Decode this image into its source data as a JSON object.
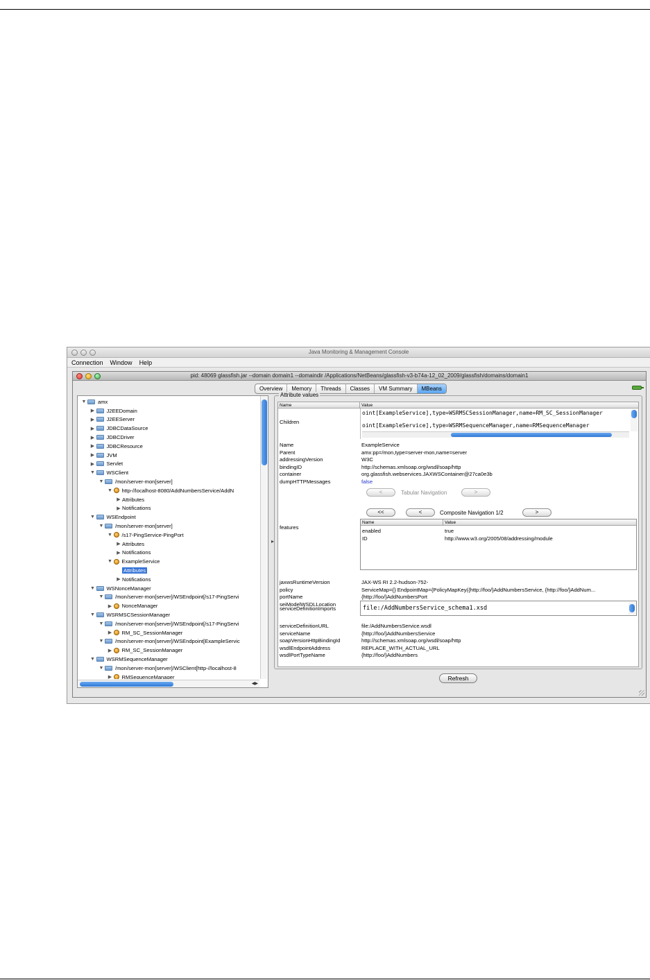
{
  "outer_window": {
    "title": "Java Monitoring & Management Console",
    "menu": [
      "Connection",
      "Window",
      "Help"
    ]
  },
  "inner_window": {
    "title": "pid: 48069 glassfish.jar --domain domain1 --domaindir /Applications/NetBeans/glassfish-v3-b74a-12_02_2009/glassfish/domains/domain1"
  },
  "tabs": [
    {
      "label": "Overview",
      "active": false
    },
    {
      "label": "Memory",
      "active": false
    },
    {
      "label": "Threads",
      "active": false
    },
    {
      "label": "Classes",
      "active": false
    },
    {
      "label": "VM Summary",
      "active": false
    },
    {
      "label": "MBeans",
      "active": true
    }
  ],
  "tree": [
    {
      "label": "amx",
      "depth": 0,
      "state": "expanded",
      "icon": "folder"
    },
    {
      "label": "J2EEDomain",
      "depth": 1,
      "state": "collapsed",
      "icon": "folder"
    },
    {
      "label": "J2EEServer",
      "depth": 1,
      "state": "collapsed",
      "icon": "folder"
    },
    {
      "label": "JDBCDataSource",
      "depth": 1,
      "state": "collapsed",
      "icon": "folder"
    },
    {
      "label": "JDBCDriver",
      "depth": 1,
      "state": "collapsed",
      "icon": "folder"
    },
    {
      "label": "JDBCResource",
      "depth": 1,
      "state": "collapsed",
      "icon": "folder"
    },
    {
      "label": "JVM",
      "depth": 1,
      "state": "collapsed",
      "icon": "folder"
    },
    {
      "label": "Servlet",
      "depth": 1,
      "state": "collapsed",
      "icon": "folder"
    },
    {
      "label": "WSClient",
      "depth": 1,
      "state": "expanded",
      "icon": "folder"
    },
    {
      "label": "/mon/server-mon[server]",
      "depth": 2,
      "state": "expanded",
      "icon": "folder"
    },
    {
      "label": "http-//localhost-8080/AddNumbersService/AddN",
      "depth": 3,
      "state": "expanded",
      "icon": "bean"
    },
    {
      "label": "Attributes",
      "depth": 4,
      "state": "collapsed",
      "icon": "none"
    },
    {
      "label": "Notifications",
      "depth": 4,
      "state": "collapsed",
      "icon": "none"
    },
    {
      "label": "WSEndpoint",
      "depth": 1,
      "state": "expanded",
      "icon": "folder"
    },
    {
      "label": "/mon/server-mon[server]",
      "depth": 2,
      "state": "expanded",
      "icon": "folder"
    },
    {
      "label": "/s17-PingService-PingPort",
      "depth": 3,
      "state": "expanded",
      "icon": "bean"
    },
    {
      "label": "Attributes",
      "depth": 4,
      "state": "collapsed",
      "icon": "none"
    },
    {
      "label": "Notifications",
      "depth": 4,
      "state": "collapsed",
      "icon": "none"
    },
    {
      "label": "ExampleService",
      "depth": 3,
      "state": "expanded",
      "icon": "bean"
    },
    {
      "label": "Attributes",
      "depth": 4,
      "state": "leaf",
      "icon": "none",
      "selected": true
    },
    {
      "label": "Notifications",
      "depth": 4,
      "state": "collapsed",
      "icon": "none"
    },
    {
      "label": "WSNonceManager",
      "depth": 1,
      "state": "expanded",
      "icon": "folder"
    },
    {
      "label": "/mon/server-mon[server]/WSEndpoint[/s17-PingServi",
      "depth": 2,
      "state": "expanded",
      "icon": "folder"
    },
    {
      "label": "NonceManager",
      "depth": 3,
      "state": "collapsed",
      "icon": "bean"
    },
    {
      "label": "WSRMSCSessionManager",
      "depth": 1,
      "state": "expanded",
      "icon": "folder"
    },
    {
      "label": "/mon/server-mon[server]/WSEndpoint[/s17-PingServi",
      "depth": 2,
      "state": "expanded",
      "icon": "folder"
    },
    {
      "label": "RM_SC_SessionManager",
      "depth": 3,
      "state": "collapsed",
      "icon": "bean"
    },
    {
      "label": "/mon/server-mon[server]/WSEndpoint[ExampleServic",
      "depth": 2,
      "state": "expanded",
      "icon": "folder"
    },
    {
      "label": "RM_SC_SessionManager",
      "depth": 3,
      "state": "collapsed",
      "icon": "bean"
    },
    {
      "label": "WSRMSequenceManager",
      "depth": 1,
      "state": "expanded",
      "icon": "folder"
    },
    {
      "label": "/mon/server-mon[server]/WSClient[http-//localhost-8",
      "depth": 2,
      "state": "expanded",
      "icon": "folder"
    },
    {
      "label": "RMSequenceManager",
      "depth": 3,
      "state": "collapsed",
      "icon": "bean"
    }
  ],
  "attributes": {
    "group_title": "Attribute values",
    "col_name": "Name",
    "col_value": "Value",
    "children_label": "Children",
    "children_values": [
      "oint[ExampleService],type=WSRMSCSessionManager,name=RM_SC_SessionManager",
      "oint[ExampleService],type=WSRMSequenceManager,name=RMSequenceManager"
    ],
    "rows_a": [
      {
        "name": "Name",
        "value": "ExampleService"
      },
      {
        "name": "Parent",
        "value": "amx:pp=/mon,type=server-mon,name=server"
      },
      {
        "name": "addressingVersion",
        "value": "W3C"
      },
      {
        "name": "bindingID",
        "value": "http://schemas.xmlsoap.org/wsdl/soap/http"
      },
      {
        "name": "container",
        "value": "org.glassfish.webservices.JAXWSContainer@27ca0e3b"
      },
      {
        "name": "dumpHTTPMessages",
        "value": "false"
      }
    ],
    "tabular_nav": {
      "prev": "<",
      "label": "Tabular Navigation",
      "next": ">"
    },
    "composite_nav": {
      "first": "<<",
      "prev": "<",
      "label": "Composite Navigation 1/2",
      "next": ">"
    },
    "features_label": "features",
    "features_table": {
      "col_name": "Name",
      "col_value": "Value",
      "rows": [
        {
          "name": "enabled",
          "value": "true"
        },
        {
          "name": "ID",
          "value": "http://www.w3.org/2005/08/addressing/module"
        }
      ]
    },
    "rows_b": [
      {
        "name": "jaxwsRuntimeVersion",
        "value": "JAX-WS RI 2.2-hudson-752-"
      },
      {
        "name": "policy",
        "value": "ServiceMap={} EndpointMap={PolicyMapKey({http://foo/}AddNumbersService, {http://foo/}AddNum..."
      },
      {
        "name": "portName",
        "value": "{http://foo/}AddNumbersPort"
      },
      {
        "name": "seiModelWSDLLocation",
        "value": ""
      }
    ],
    "service_definition_imports_label": "serviceDefinitionImports",
    "service_definition_imports_value": "file:/AddNumbersService_schema1.xsd",
    "rows_c": [
      {
        "name": "serviceDefinitionURL",
        "value": "file:/AddNumbersService.wsdl"
      },
      {
        "name": "serviceName",
        "value": "{http://foo/}AddNumbersService"
      },
      {
        "name": "soapVersionHttpBindingId",
        "value": "http://schemas.xmlsoap.org/wsdl/soap/http"
      },
      {
        "name": "wsdlEndpointAddress",
        "value": "REPLACE_WITH_ACTUAL_URL"
      },
      {
        "name": "wsdlPortTypeName",
        "value": "{http://foo/}AddNumbers"
      }
    ]
  },
  "refresh_label": "Refresh"
}
